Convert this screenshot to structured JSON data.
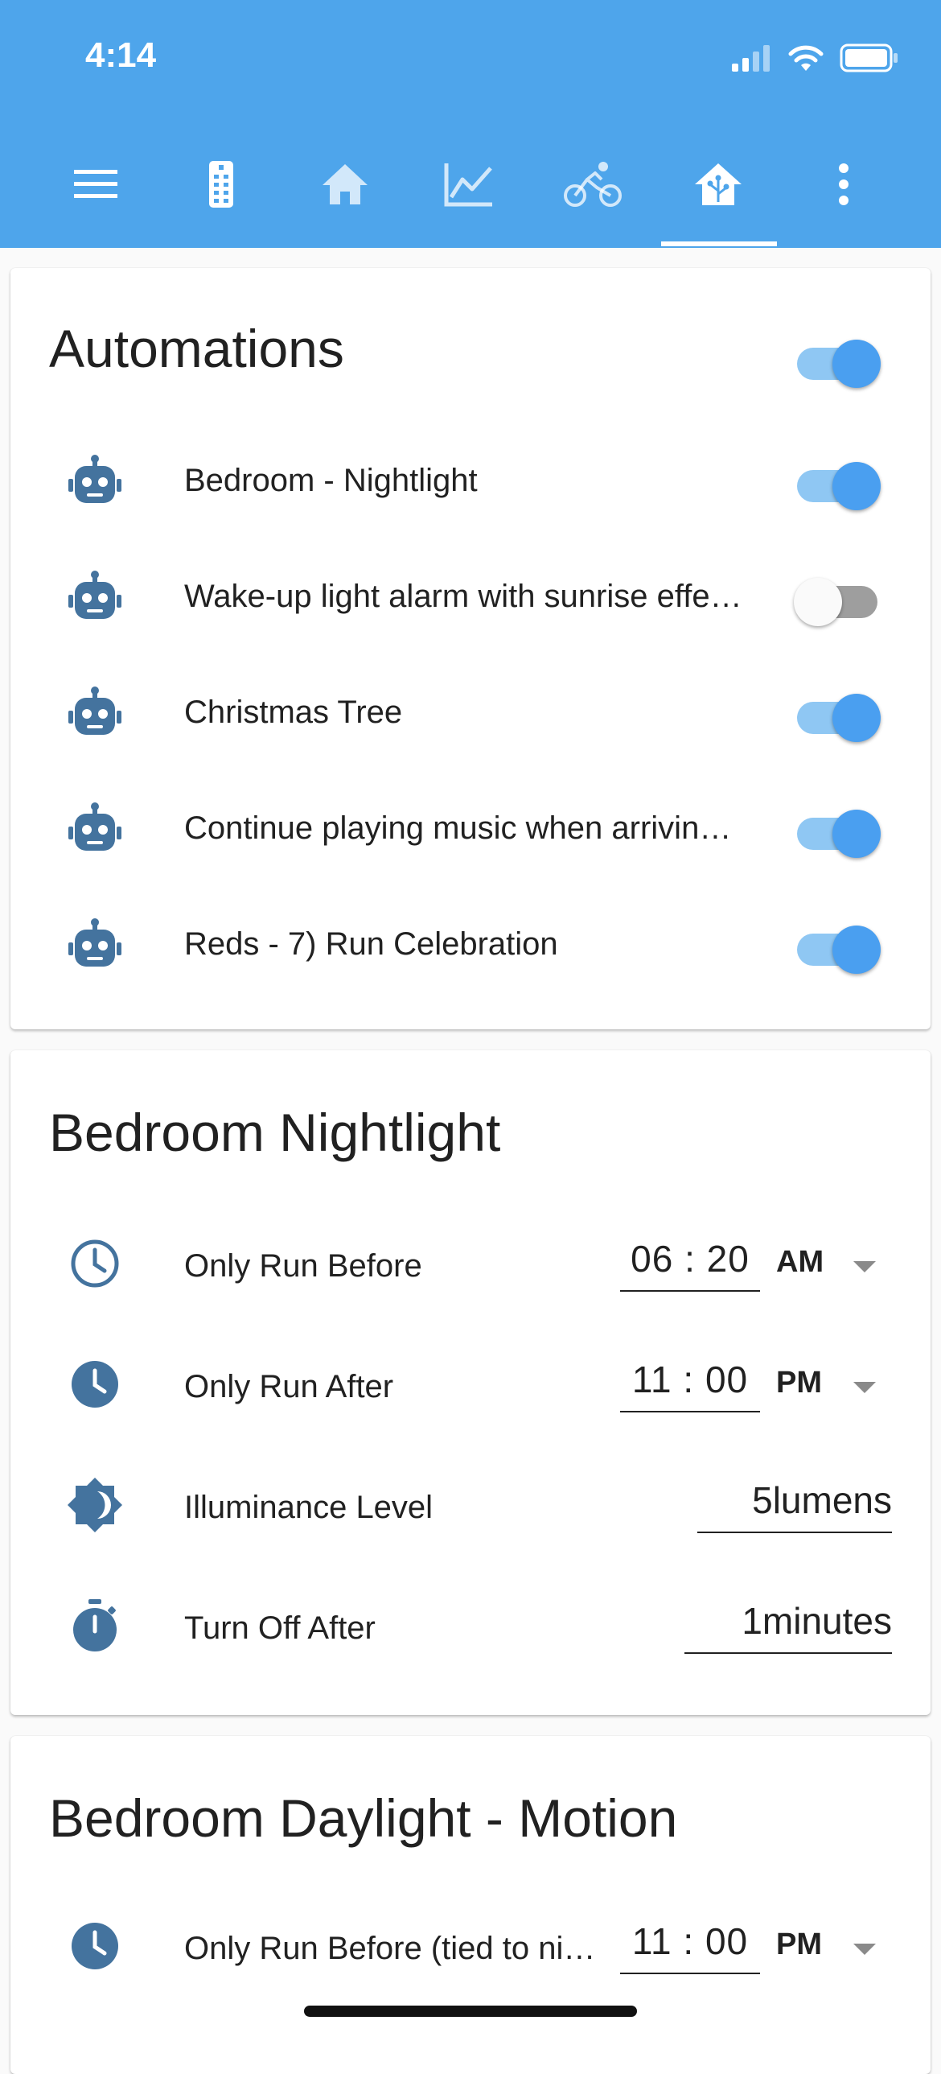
{
  "status_bar": {
    "time": "4:14"
  },
  "toolbar": {
    "icons": [
      "menu-icon",
      "remote-icon",
      "home-icon",
      "chart-icon",
      "bicycle-icon",
      "smart-home-icon",
      "more-vert-icon"
    ],
    "active_tab": "smart-home-icon"
  },
  "automations": {
    "title": "Automations",
    "master_toggle_on": true,
    "items": [
      {
        "label": "Bedroom - Nightlight",
        "on": true
      },
      {
        "label": "Wake-up light alarm with sunrise effe…",
        "on": false
      },
      {
        "label": "Christmas Tree",
        "on": true
      },
      {
        "label": "Continue playing music when arrivin…",
        "on": true
      },
      {
        "label": "Reds - 7) Run Celebration",
        "on": true
      }
    ]
  },
  "bedroom_nightlight": {
    "title": "Bedroom Nightlight",
    "only_run_before": {
      "label": "Only Run Before",
      "time": "06 : 20",
      "ampm": "AM"
    },
    "only_run_after": {
      "label": "Only Run After",
      "time": "11 : 00",
      "ampm": "PM"
    },
    "illuminance": {
      "label": "Illuminance Level",
      "value": "5lumens"
    },
    "turn_off_after": {
      "label": "Turn Off After",
      "value": "1minutes"
    }
  },
  "bedroom_daylight": {
    "title": "Bedroom Daylight - Motion",
    "only_run_before": {
      "label": "Only Run Before (tied to ni…",
      "time": "11 : 00",
      "ampm": "PM"
    }
  },
  "colors": {
    "primary": "#4ea5eb",
    "toggle_on": "#4a9ff0",
    "icon": "#44739e"
  }
}
